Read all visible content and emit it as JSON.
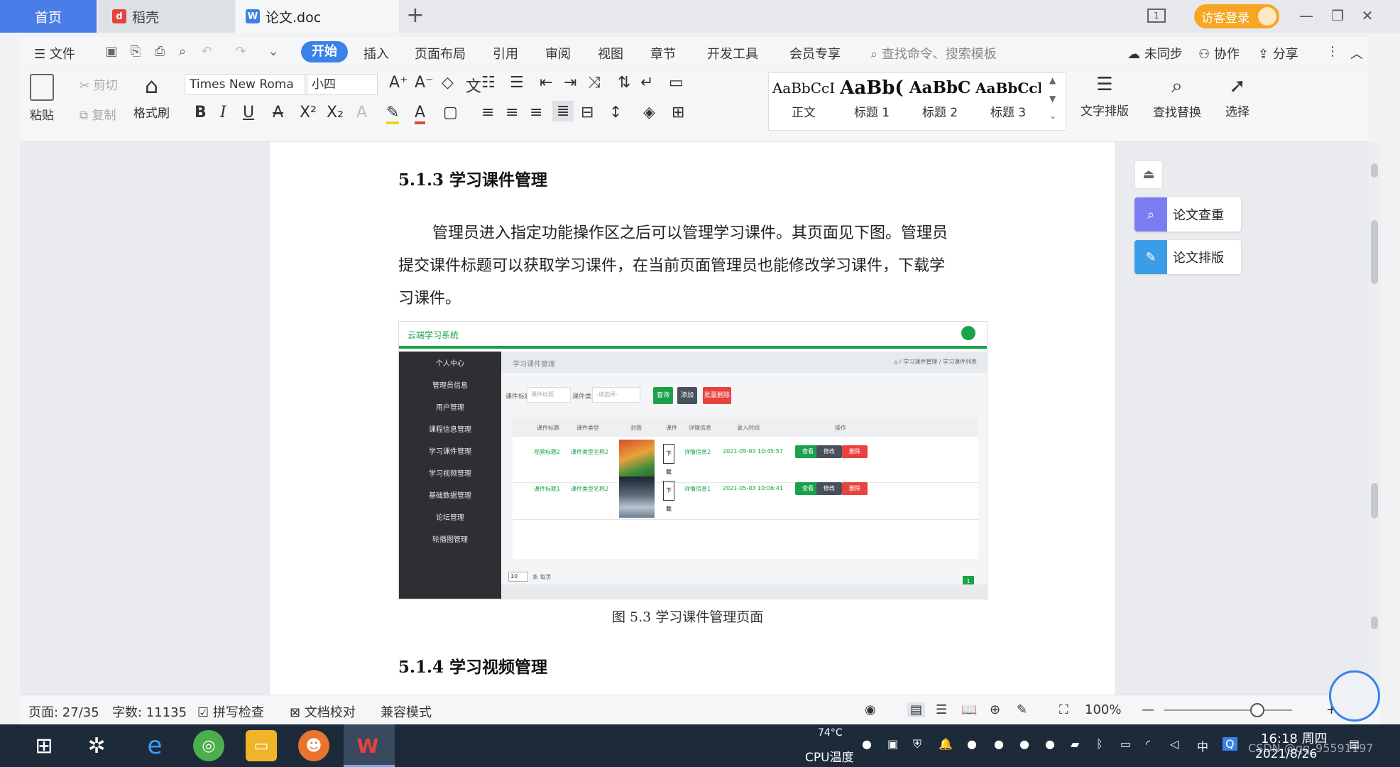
{
  "tabs": {
    "home": "首页",
    "daoke": "稻壳",
    "doc": "论文.doc",
    "new_tab": "+"
  },
  "titlebar": {
    "layout_btn": "1",
    "login": "访客登录",
    "minimize": "—",
    "restore": "❐",
    "close": "✕"
  },
  "menu": {
    "file": "文件",
    "start": "开始",
    "insert": "插入",
    "page_layout": "页面布局",
    "reference": "引用",
    "review": "审阅",
    "view": "视图",
    "chapter": "章节",
    "dev_tools": "开发工具",
    "member": "会员专享",
    "search_placeholder": "查找命令、搜索模板",
    "unsync": "未同步",
    "collab": "协作",
    "share": "分享"
  },
  "ribbon": {
    "paste": "粘贴",
    "cut": "剪切",
    "copy": "复制",
    "format_painter": "格式刷",
    "font_name": "Times New Roma",
    "font_size": "小四",
    "styles": [
      {
        "preview": "AaBbCcI",
        "name": "正文"
      },
      {
        "preview": "AaBb(",
        "name": "标题 1"
      },
      {
        "preview": "AaBbC",
        "name": "标题 2"
      },
      {
        "preview": "AaBbCcl",
        "name": "标题 3"
      }
    ],
    "text_layout": "文字排版",
    "find_replace": "查找替换",
    "select": "选择"
  },
  "document": {
    "heading_513": "5.1.3  学习课件管理",
    "para_line1": "管理员进入指定功能操作区之后可以管理学习课件。其页面见下图。管理员",
    "para_line2": "提交课件标题可以获取学习课件，在当前页面管理员也能修改学习课件，下载学",
    "para_line3": "习课件。",
    "caption": "图 5.3  学习课件管理页面",
    "heading_514": "5.1.4  学习视频管理"
  },
  "embedded": {
    "system_title": "云端学习系统",
    "sidebar": [
      "个人中心",
      "管理员信息",
      "用户管理",
      "课程信息管理",
      "学习课件管理",
      "学习视频管理",
      "基础数据管理",
      "论坛管理",
      "轮播图管理"
    ],
    "page_title": "学习课件管理",
    "breadcrumb": "⌂ / 学习课件管理 / 学习课件列表",
    "search": {
      "title_label": "课件标题",
      "title_placeholder": "课件标题",
      "type_label": "课件类型",
      "type_placeholder": "-请选择-",
      "query": "查询",
      "add": "添加",
      "batch_delete": "批量删除"
    },
    "columns": [
      "课件标题",
      "课件类型",
      "封面",
      "课件",
      "详情信息",
      "录入时间",
      "操作"
    ],
    "rows": [
      {
        "title": "视频标题2",
        "type": "课件类型名称2",
        "file": "下载",
        "detail": "详情信息2",
        "time": "2021-05-03 10:45:57"
      },
      {
        "title": "课件标题1",
        "type": "课件类型名称2",
        "file": "下载",
        "detail": "详情信息1",
        "time": "2021-05-03 10:06:41"
      }
    ],
    "actions": {
      "view": "查看",
      "edit": "修改",
      "delete": "删除"
    },
    "page_size": "10",
    "page_size_label": "条 每页",
    "page_number": "1"
  },
  "side_panel": {
    "collapse": "⏏",
    "check": "论文查重",
    "layout": "论文排版"
  },
  "status": {
    "page": "页面: 27/35",
    "words": "字数: 11135",
    "spellcheck": "拼写检查",
    "doc_check": "文档校对",
    "compat": "兼容模式",
    "zoom": "100%",
    "zoom_minus": "—",
    "zoom_plus": "+"
  },
  "taskbar": {
    "cpu_temp": "74°C",
    "cpu_label": "CPU温度",
    "ime": "中",
    "time": "16:18 周四",
    "date": "2021/8/26",
    "watermark": "CSDN @qq_95591197"
  },
  "colors": {
    "accent": "#3b82e8",
    "embedded_green": "#19a24a",
    "embedded_dark": "#2e2f33",
    "login_orange": "#f5a623",
    "delete_red": "#e8423f",
    "edit_gray": "#4a4f5c"
  }
}
